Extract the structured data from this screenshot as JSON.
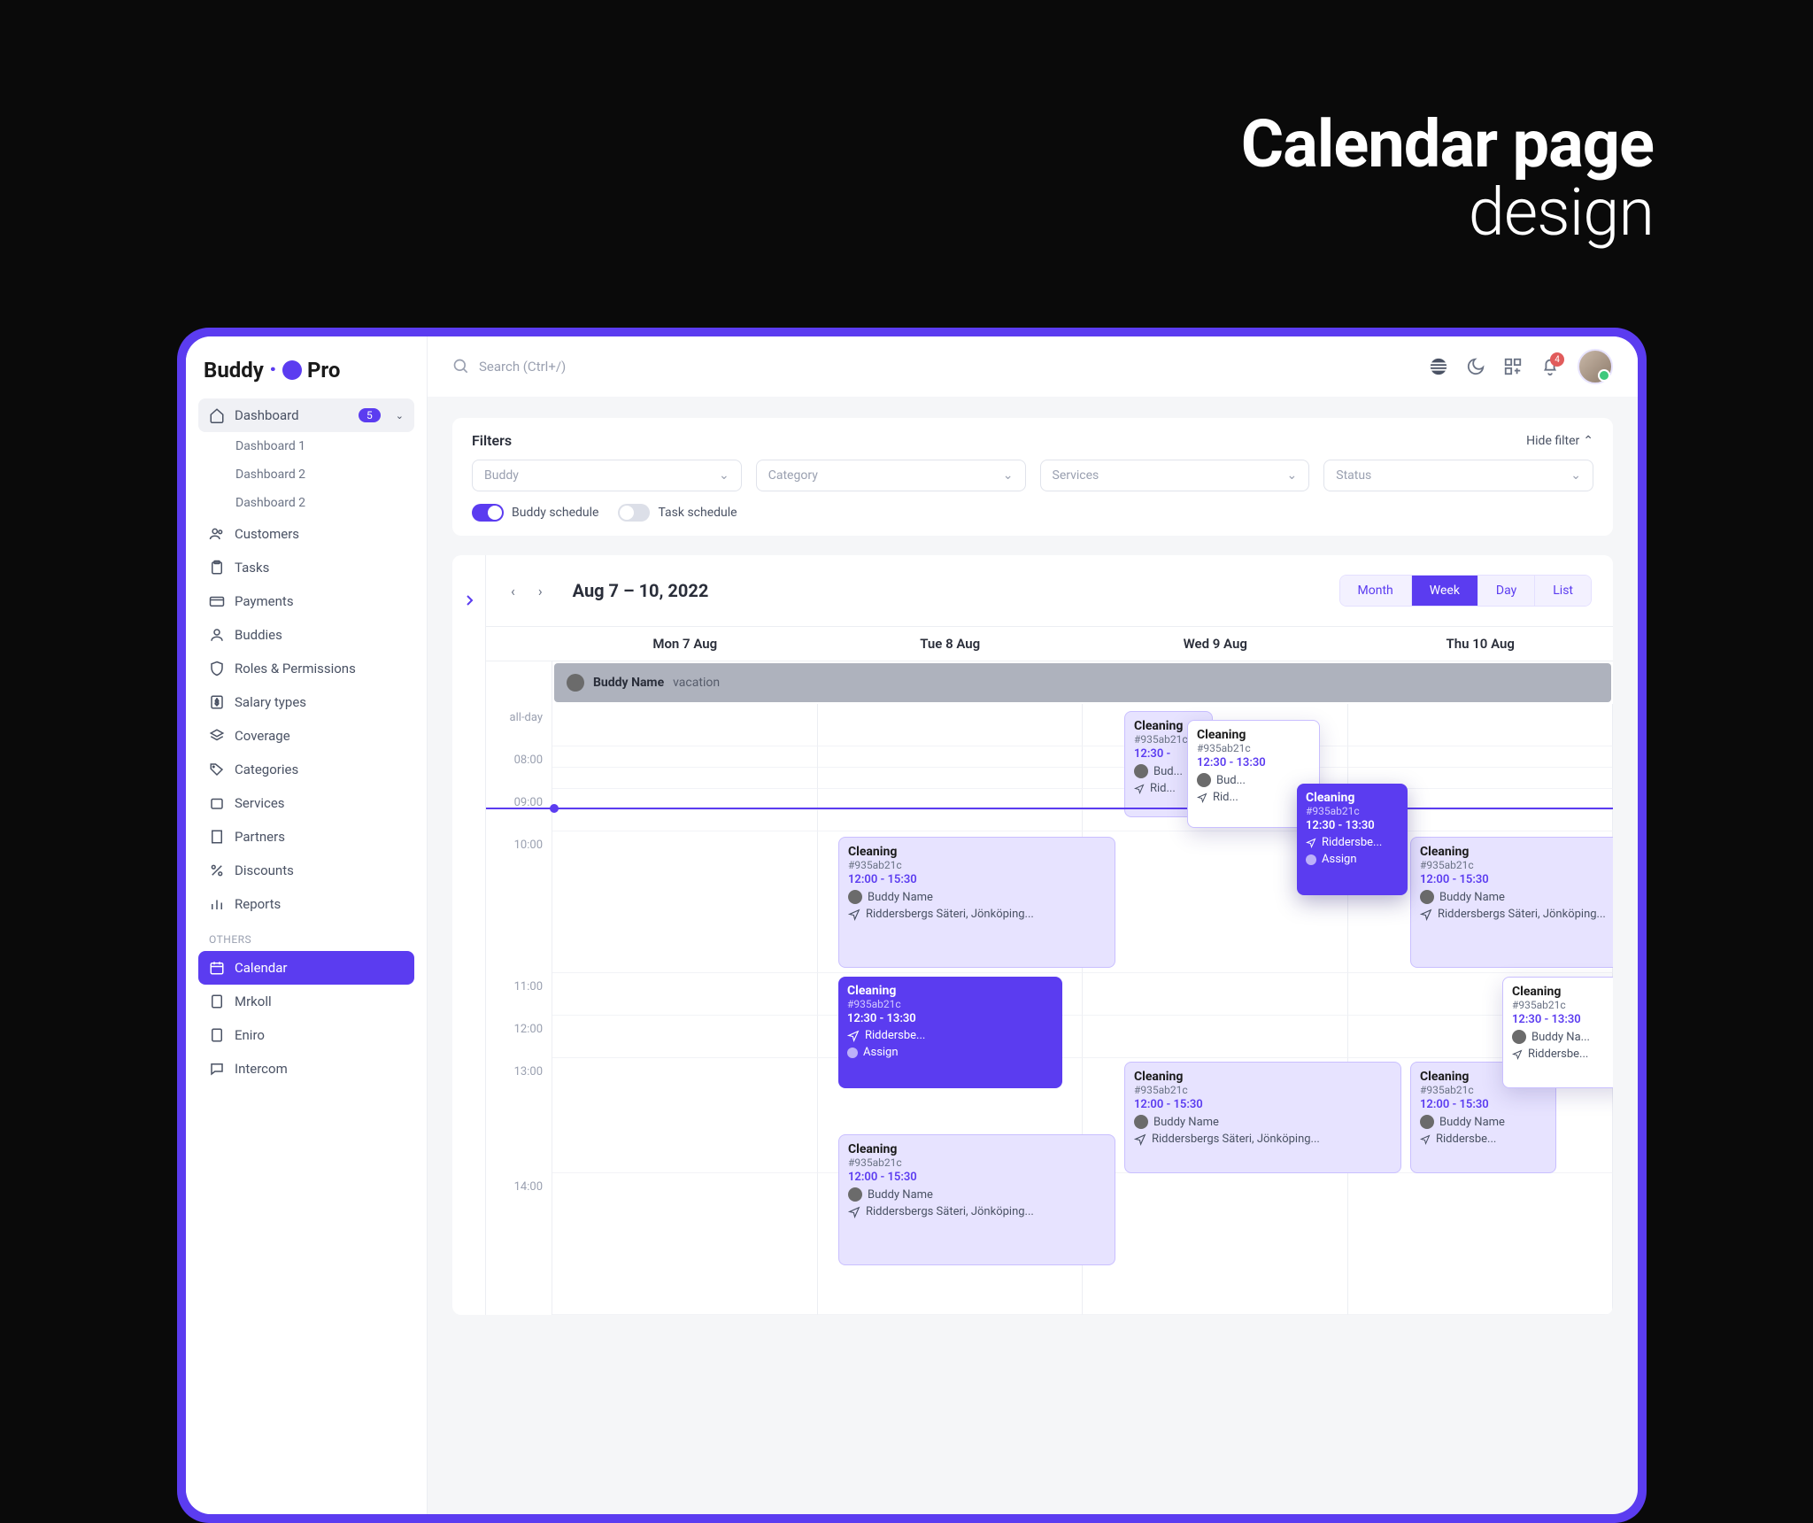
{
  "hero": {
    "title": "Calendar page",
    "subtitle": "design"
  },
  "brand": {
    "part1": "Buddy",
    "part2": "Pro"
  },
  "sidebar": {
    "dashboard": {
      "label": "Dashboard",
      "badge": "5",
      "subs": [
        "Dashboard 1",
        "Dashboard 2",
        "Dashboard 2"
      ]
    },
    "items": [
      "Customers",
      "Tasks",
      "Payments",
      "Buddies",
      "Roles & Permissions",
      "Salary types",
      "Coverage",
      "Categories",
      "Services",
      "Partners",
      "Discounts",
      "Reports"
    ],
    "section": "OTHERS",
    "others": [
      "Calendar",
      "Mrkoll",
      "Eniro",
      "Intercom"
    ]
  },
  "topbar": {
    "search_placeholder": "Search (Ctrl+/)",
    "notif_count": "4"
  },
  "filters": {
    "title": "Filters",
    "hide": "Hide filter",
    "selects": [
      "Buddy",
      "Category",
      "Services",
      "Status"
    ],
    "toggle1": "Buddy schedule",
    "toggle2": "Task schedule"
  },
  "calendar": {
    "range": "Aug 7 – 10, 2022",
    "views": [
      "Month",
      "Week",
      "Day",
      "List"
    ],
    "days": [
      "Mon 7 Aug",
      "Tue 8 Aug",
      "Wed 9 Aug",
      "Thu 10 Aug"
    ],
    "banner_name": "Buddy Name",
    "banner_status": "vacation",
    "allday": "all-day",
    "hours": [
      "08:00",
      "09:00",
      "10:00",
      "11:00",
      "12:00",
      "13:00",
      "14:00"
    ]
  },
  "ev": {
    "cleaning": "Cleaning",
    "id": "#935ab21c",
    "t1230": "12:30 - 13:30",
    "t1200": "12:00 - 15:30",
    "t1230short": "12:30 -",
    "buddy": "Buddy Name",
    "buddy_short": "Buddy Na...",
    "bud_short": "Bud...",
    "loc_full": "Riddersbergs Säteri, Jönköping...",
    "loc_short": "Riddersbe...",
    "assign": "Assign",
    "rid": "Rid..."
  }
}
